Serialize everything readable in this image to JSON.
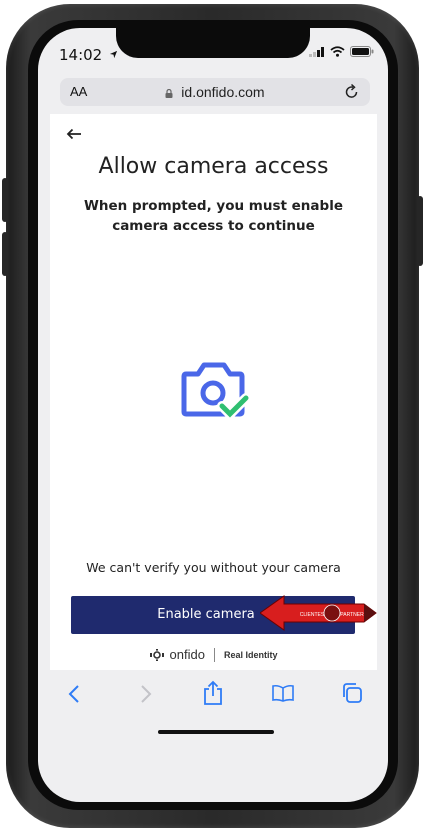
{
  "status_bar": {
    "time": "14:02"
  },
  "browser": {
    "text_size_label": "AA",
    "url": "id.onfido.com"
  },
  "page": {
    "title": "Allow camera access",
    "subtitle": "When prompted, you must enable camera access to continue",
    "note": "We can't verify you without your camera",
    "primary_button": "Enable camera",
    "overlay_badge_left": "CLIENTES",
    "overlay_badge_right": "PARTNER",
    "brand_name": "onfido",
    "brand_tagline": "Real Identity"
  },
  "colors": {
    "button": "#1f2a6e",
    "camera_icon": "#4a67e8",
    "check": "#2fbf71",
    "pointer": "#d81e1e"
  },
  "icons": {
    "back": "arrow-left-icon",
    "lock": "lock-icon",
    "reload": "reload-icon",
    "camera": "camera-icon",
    "check": "check-icon",
    "toolbar": [
      "chevron-left-icon",
      "chevron-right-icon",
      "share-icon",
      "bookmarks-icon",
      "tabs-icon"
    ]
  }
}
